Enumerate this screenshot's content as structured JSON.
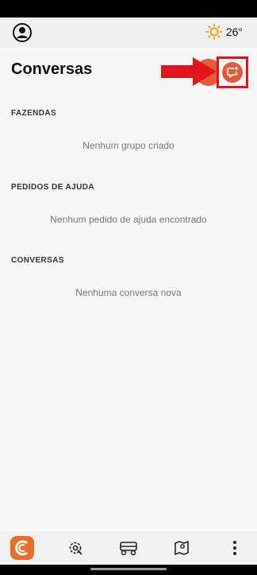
{
  "topbar": {
    "temperature": "26°"
  },
  "page": {
    "title": "Conversas"
  },
  "sections": [
    {
      "label": "FAZENDAS",
      "empty": "Nenhum grupo criado"
    },
    {
      "label": "PEDIDOS DE AJUDA",
      "empty": "Nenhum pedido de ajuda encontrado"
    },
    {
      "label": "CONVERSAS",
      "empty": "Nenhuma conversa nova"
    }
  ],
  "colors": {
    "accent": "#e45b3b",
    "highlight": "#e3141b",
    "logo": "#ef6b28"
  },
  "icons": [
    "profile-icon",
    "sun-icon",
    "new-chat-icon",
    "arrow-right-icon",
    "app-logo-icon",
    "settings-icon",
    "vehicle-icon",
    "map-icon",
    "more-icon"
  ]
}
